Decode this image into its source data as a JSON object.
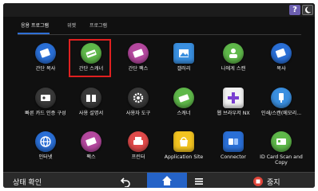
{
  "topbar": {
    "help_label": "?",
    "night_icon": "moon-icon"
  },
  "tabs": [
    {
      "label": "응용 프로그램",
      "active": true
    },
    {
      "label": "위젯",
      "active": false
    },
    {
      "label": "프로그램",
      "active": false
    }
  ],
  "apps": [
    {
      "label": "간단 복사",
      "icon": "copy-icon",
      "color": "#2a6fd6"
    },
    {
      "label": "간단 스캐너",
      "icon": "scanner-icon",
      "color": "#5fb84a"
    },
    {
      "label": "간단 팩스",
      "icon": "fax-icon",
      "color": "#b5489f"
    },
    {
      "label": "갤러리",
      "icon": "gallery-icon",
      "color": "#3a8fe0"
    },
    {
      "label": "나에게 스캔",
      "icon": "scan-to-me-icon",
      "color": "#5fb84a"
    },
    {
      "label": "복사",
      "icon": "copy-icon",
      "color": "#2a6fd6"
    },
    {
      "label": "빠른 카드 인증 구성",
      "icon": "card-auth-icon",
      "color": "#3a3a3a"
    },
    {
      "label": "사용 설명서",
      "icon": "manual-icon",
      "color": "#3a3a3a"
    },
    {
      "label": "사용자 도구",
      "icon": "gear-icon",
      "color": "#3a3a3a"
    },
    {
      "label": "스캐너",
      "icon": "scanner-icon",
      "color": "#5fb84a"
    },
    {
      "label": "웹 브라우저 NX",
      "icon": "web-browser-icon",
      "color": "#f2f2f2"
    },
    {
      "label": "인쇄/스캔(메모리...",
      "icon": "print-scan-memory-icon",
      "color": "#3a8fe0"
    },
    {
      "label": "인터넷",
      "icon": "internet-icon",
      "color": "#2a6fd6"
    },
    {
      "label": "팩스",
      "icon": "fax-icon",
      "color": "#b5489f"
    },
    {
      "label": "프린터",
      "icon": "printer-icon",
      "color": "#e04a4a"
    },
    {
      "label": "Application Site",
      "icon": "application-site-icon",
      "color": "#f2c320"
    },
    {
      "label": "Connector",
      "icon": "connector-icon",
      "color": "#2a6fd6"
    },
    {
      "label": "ID Card Scan and Copy",
      "icon": "id-card-scan-icon",
      "color": "#5fb84a"
    }
  ],
  "bottombar": {
    "status_label": "상태 확인",
    "stop_label": "중지"
  }
}
